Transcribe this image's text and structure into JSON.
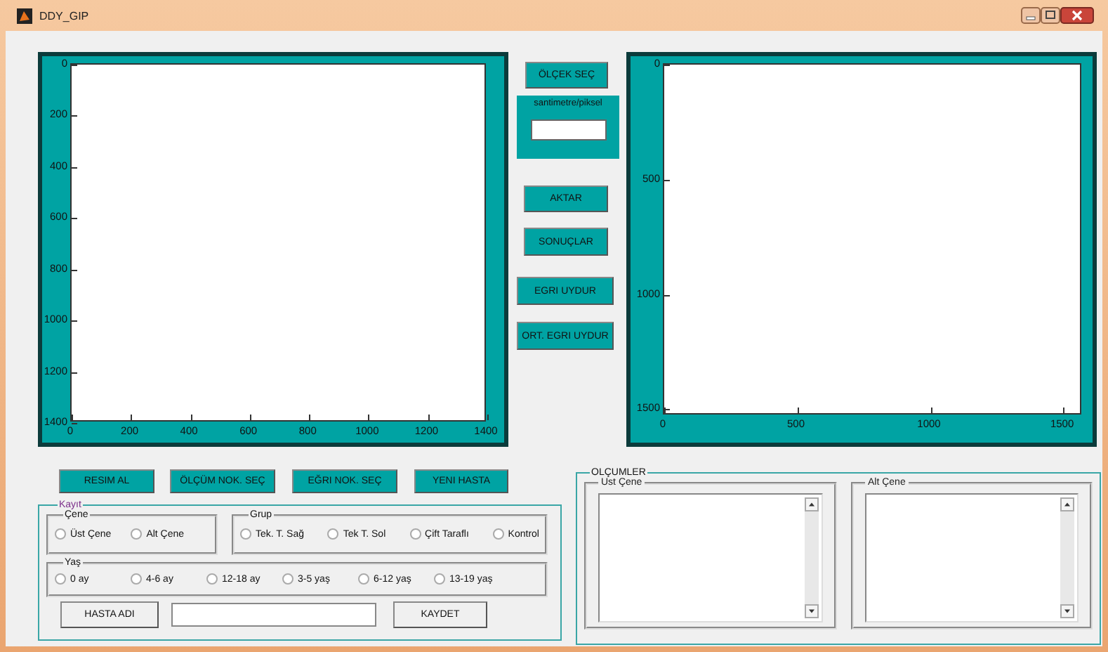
{
  "window": {
    "title": "DDY_GIP"
  },
  "left_axes": {
    "xticks": [
      "0",
      "200",
      "400",
      "600",
      "800",
      "1000",
      "1200",
      "1400"
    ],
    "yticks": [
      "0",
      "200",
      "400",
      "600",
      "800",
      "1000",
      "1200",
      "1400"
    ]
  },
  "scale_button": "ÖLÇEK SEÇ",
  "scale_box": {
    "label": "santimetre/piksel"
  },
  "middle_buttons": [
    "AKTAR",
    "SONUÇLAR",
    "EGRI UYDUR",
    "ORT. EGRI UYDUR"
  ],
  "right_axes": {
    "xticks": [
      "0",
      "500",
      "1000",
      "1500"
    ],
    "yticks": [
      "0",
      "500",
      "1000",
      "1500"
    ]
  },
  "bottom_buttons": [
    "RESIM AL",
    "ÖLÇÜM NOK. SEÇ",
    "EĞRI NOK. SEÇ",
    "YENI HASTA"
  ],
  "record": {
    "title": "Kayıt",
    "groups": [
      {
        "title": "Çene",
        "options": [
          {
            "label": "Üst Çene",
            "selected": false
          },
          {
            "label": "Alt Çene",
            "selected": false
          }
        ]
      },
      {
        "title": "Grup",
        "options": [
          {
            "label": "Tek. T. Sağ",
            "selected": false
          },
          {
            "label": "Tek T. Sol",
            "selected": false
          },
          {
            "label": "Çift Taraflı",
            "selected": false
          },
          {
            "label": "Kontrol",
            "selected": false
          }
        ]
      },
      {
        "title": "Yaş",
        "options": [
          {
            "label": "0 ay",
            "selected": false
          },
          {
            "label": "4-6 ay",
            "selected": false
          },
          {
            "label": "12-18 ay",
            "selected": false
          },
          {
            "label": "3-5 yaş",
            "selected": false
          },
          {
            "label": "6-12 yaş",
            "selected": false
          },
          {
            "label": "13-19 yaş",
            "selected": false
          }
        ]
      }
    ],
    "name_button": "HASTA ADI",
    "save_button": "KAYDET"
  },
  "measurements": {
    "title": "OLÇUMLER",
    "lists": [
      {
        "title": "Ust Çene"
      },
      {
        "title": "Alt Çene"
      }
    ]
  }
}
